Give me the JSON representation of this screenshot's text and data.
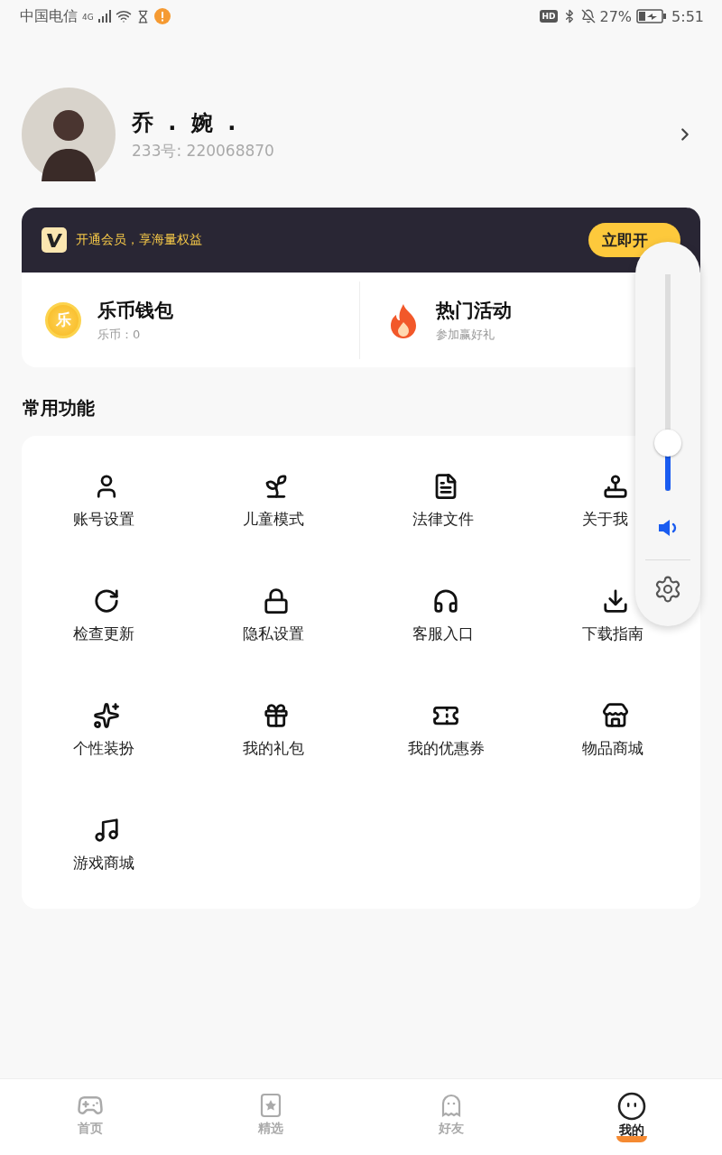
{
  "status_bar": {
    "carrier": "中国电信",
    "network": "4G",
    "hd": "HD",
    "battery": "27%",
    "time": "5:51"
  },
  "profile": {
    "name": "乔 . 婉 .",
    "id": "233号: 220068870"
  },
  "vip": {
    "text": "开通会员，享海量权益",
    "button": "立即开"
  },
  "wallet": [
    {
      "kind": "coin",
      "badge": "乐",
      "title": "乐币钱包",
      "subtitle": "乐币：0"
    },
    {
      "kind": "fire",
      "title": "热门活动",
      "subtitle": "参加赢好礼"
    }
  ],
  "section_title": "常用功能",
  "functions": [
    "账号设置",
    "儿童模式",
    "法律文件",
    "关于我",
    "检查更新",
    "隐私设置",
    "客服入口",
    "下载指南",
    "个性装扮",
    "我的礼包",
    "我的优惠券",
    "物品商城",
    "游戏商城"
  ],
  "volume": {
    "level": 0.22
  },
  "tabs": [
    {
      "label": "首页",
      "selected": false
    },
    {
      "label": "精选",
      "selected": false
    },
    {
      "label": "好友",
      "selected": false
    },
    {
      "label": "我的",
      "selected": true
    }
  ]
}
